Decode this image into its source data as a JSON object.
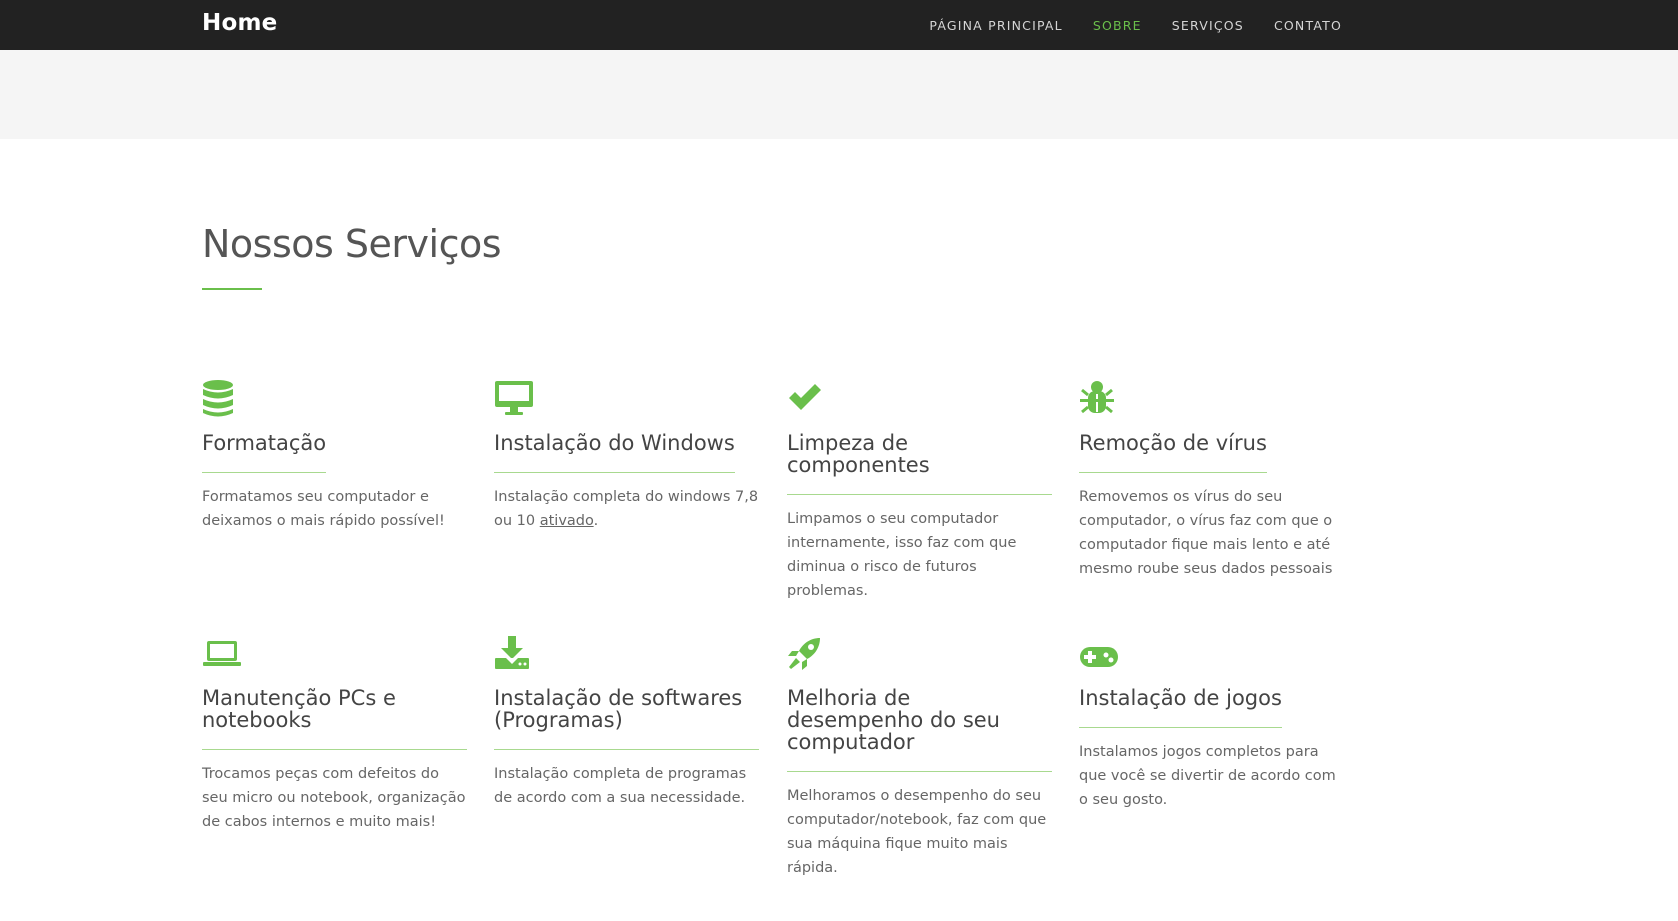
{
  "navbar": {
    "brand": "Home",
    "links": [
      {
        "label": "PÁGINA PRINCIPAL",
        "active": false
      },
      {
        "label": "SOBRE",
        "active": true
      },
      {
        "label": "SERVIÇOS",
        "active": false
      },
      {
        "label": "CONTATO",
        "active": false
      }
    ]
  },
  "colors": {
    "accent": "#6abf4b",
    "navbar_bg": "#222222",
    "band_bg": "#f5f5f5"
  },
  "section": {
    "title": "Nossos Serviços"
  },
  "services": [
    {
      "icon": "database-icon",
      "title": "Formatação",
      "text": "Formatamos seu computador e deixamos o mais rápido possível!"
    },
    {
      "icon": "desktop-icon",
      "title": "Instalação do Windows",
      "text_before": "Instalação completa do windows 7,8 ou 10 ",
      "link": "ativado",
      "text_after": "."
    },
    {
      "icon": "check-icon",
      "title": "Limpeza de componentes",
      "text": "Limpamos o seu computador internamente, isso faz com que diminua o risco de futuros problemas."
    },
    {
      "icon": "bug-icon",
      "title": "Remoção de vírus",
      "text": "Removemos os vírus do seu computador, o vírus faz com que o computador fique mais lento e até mesmo roube seus dados pessoais"
    },
    {
      "icon": "laptop-icon",
      "title": "Manutenção PCs e notebooks",
      "text": "Trocamos peças com defeitos do seu micro ou notebook, organização de cabos internos e muito mais!"
    },
    {
      "icon": "download-icon",
      "title": "Instalação de softwares (Programas)",
      "text": "Instalação completa de programas de acordo com a sua necessidade."
    },
    {
      "icon": "rocket-icon",
      "title": "Melhoria de desempenho do seu computador",
      "text": "Melhoramos o desempenho do seu computador/notebook, faz com que sua máquina fique muito mais rápida."
    },
    {
      "icon": "gamepad-icon",
      "title": "Instalação de jogos",
      "text": "Instalamos jogos completos para que você se divertir de acordo com o seu gosto."
    }
  ]
}
